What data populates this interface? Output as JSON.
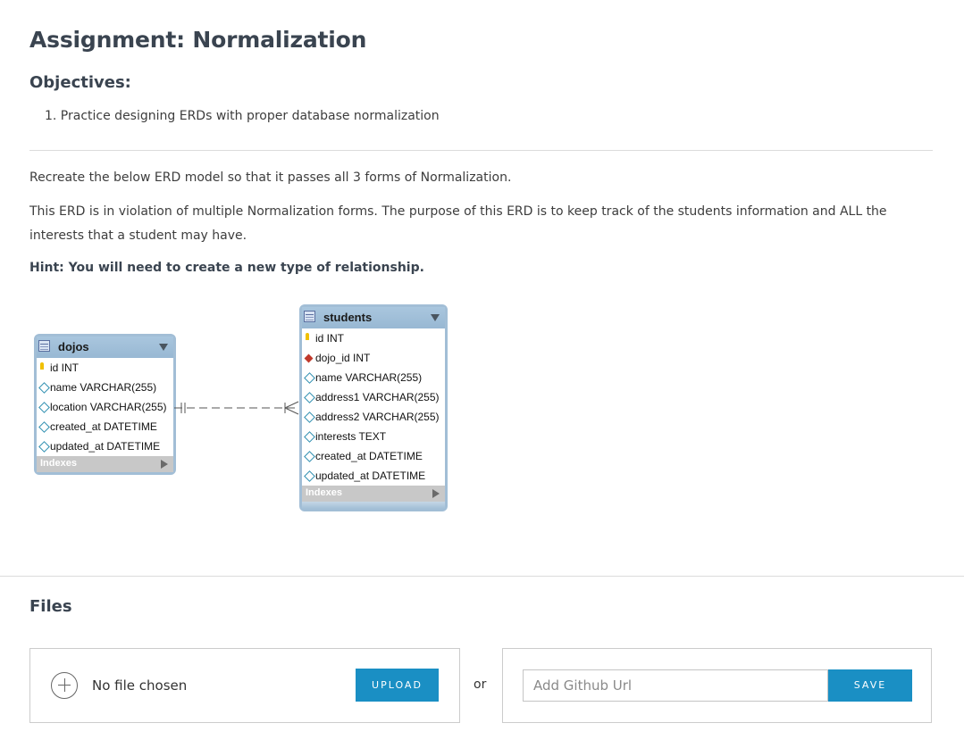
{
  "assignment": {
    "title": "Assignment: Normalization",
    "objectives_heading": "Objectives:",
    "objectives": [
      "1. Practice designing ERDs with proper database normalization"
    ],
    "intro": "Recreate the below ERD model so that it passes all 3 forms of Normalization.",
    "description": "This ERD is in violation of multiple Normalization forms. The purpose of this ERD is to keep track of the students information and ALL the interests that a student may have.",
    "hint": "Hint: You will need to create a new type of relationship."
  },
  "erd": {
    "dojos": {
      "name": "dojos",
      "columns": [
        {
          "text": "id INT",
          "kind": "primary-key"
        },
        {
          "text": "name VARCHAR(255)",
          "kind": "attribute"
        },
        {
          "text": "location VARCHAR(255)",
          "kind": "attribute"
        },
        {
          "text": "created_at DATETIME",
          "kind": "attribute"
        },
        {
          "text": "updated_at DATETIME",
          "kind": "attribute"
        }
      ],
      "indexes_label": "Indexes"
    },
    "students": {
      "name": "students",
      "columns": [
        {
          "text": "id INT",
          "kind": "primary-key"
        },
        {
          "text": "dojo_id INT",
          "kind": "foreign-key"
        },
        {
          "text": "name VARCHAR(255)",
          "kind": "attribute"
        },
        {
          "text": "address1 VARCHAR(255)",
          "kind": "attribute"
        },
        {
          "text": "address2 VARCHAR(255)",
          "kind": "attribute"
        },
        {
          "text": "interests TEXT",
          "kind": "attribute"
        },
        {
          "text": "created_at DATETIME",
          "kind": "attribute"
        },
        {
          "text": "updated_at DATETIME",
          "kind": "attribute"
        }
      ],
      "indexes_label": "Indexes"
    }
  },
  "files": {
    "heading": "Files",
    "no_file_text": "No file chosen",
    "upload_label": "UPLOAD",
    "or_label": "or",
    "github_placeholder": "Add Github Url",
    "save_label": "SAVE",
    "button_color": "#1a8fc4"
  }
}
